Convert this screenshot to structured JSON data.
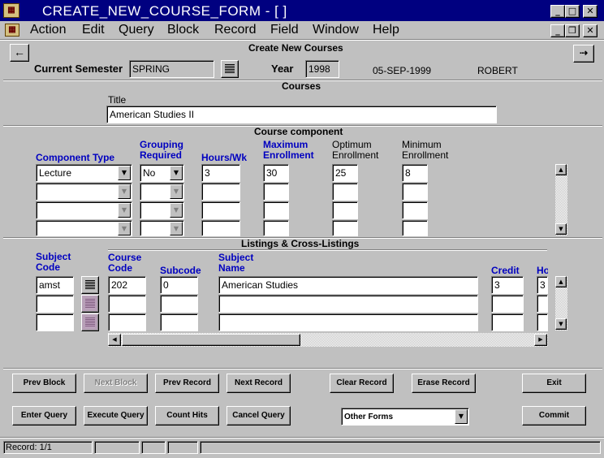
{
  "window": {
    "title": "CREATE_NEW_COURSE_FORM - [ ]"
  },
  "menu": {
    "items": [
      "Action",
      "Edit",
      "Query",
      "Block",
      "Record",
      "Field",
      "Window",
      "Help"
    ]
  },
  "form": {
    "title": "Create New Courses",
    "current_semester_label": "Current Semester",
    "current_semester_value": "SPRING",
    "year_label": "Year",
    "year_value": "1998",
    "date": "05-SEP-1999",
    "user": "ROBERT"
  },
  "courses": {
    "section_title": "Courses",
    "title_label": "Title",
    "title_value": "American Studies II"
  },
  "component": {
    "section_title": "Course component",
    "headers": {
      "component_type": "Component Type",
      "grouping_1": "Grouping",
      "grouping_2": "Required",
      "hours": "Hours/Wk",
      "max_1": "Maximum",
      "max_2": "Enrollment",
      "opt_1": "Optimum",
      "opt_2": "Enrollment",
      "min_1": "Minimum",
      "min_2": "Enrollment"
    },
    "rows": [
      {
        "component_type": "Lecture",
        "grouping": "No",
        "hours": "3",
        "max": "30",
        "opt": "25",
        "min": "8"
      },
      {
        "component_type": "",
        "grouping": "",
        "hours": "",
        "max": "",
        "opt": "",
        "min": ""
      },
      {
        "component_type": "",
        "grouping": "",
        "hours": "",
        "max": "",
        "opt": "",
        "min": ""
      },
      {
        "component_type": "",
        "grouping": "",
        "hours": "",
        "max": "",
        "opt": "",
        "min": ""
      }
    ]
  },
  "listings": {
    "section_title": "Listings & Cross-Listings",
    "headers": {
      "subject_1": "Subject",
      "subject_2": "Code",
      "course_1": "Course",
      "course_2": "Code",
      "subcode": "Subcode",
      "name_1": "Subject",
      "name_2": "Name",
      "credit": "Credit",
      "hours_partial": "Ho"
    },
    "rows": [
      {
        "subject_code": "amst",
        "course_code": "202",
        "subcode": "0",
        "subject_name": "American Studies",
        "credit": "3",
        "hours": "3"
      },
      {
        "subject_code": "",
        "course_code": "",
        "subcode": "",
        "subject_name": "",
        "credit": "",
        "hours": ""
      },
      {
        "subject_code": "",
        "course_code": "",
        "subcode": "",
        "subject_name": "",
        "credit": "",
        "hours": ""
      }
    ]
  },
  "buttons": {
    "prev_block": "Prev Block",
    "next_block": "Next Block",
    "prev_record": "Prev Record",
    "next_record": "Next Record",
    "clear_record": "Clear Record",
    "erase_record": "Erase Record",
    "exit": "Exit",
    "enter_query": "Enter Query",
    "execute_query": "Execute Query",
    "count_hits": "Count Hits",
    "cancel_query": "Cancel Query",
    "other_forms": "Other Forms",
    "commit": "Commit"
  },
  "status": {
    "record": "Record: 1/1"
  }
}
